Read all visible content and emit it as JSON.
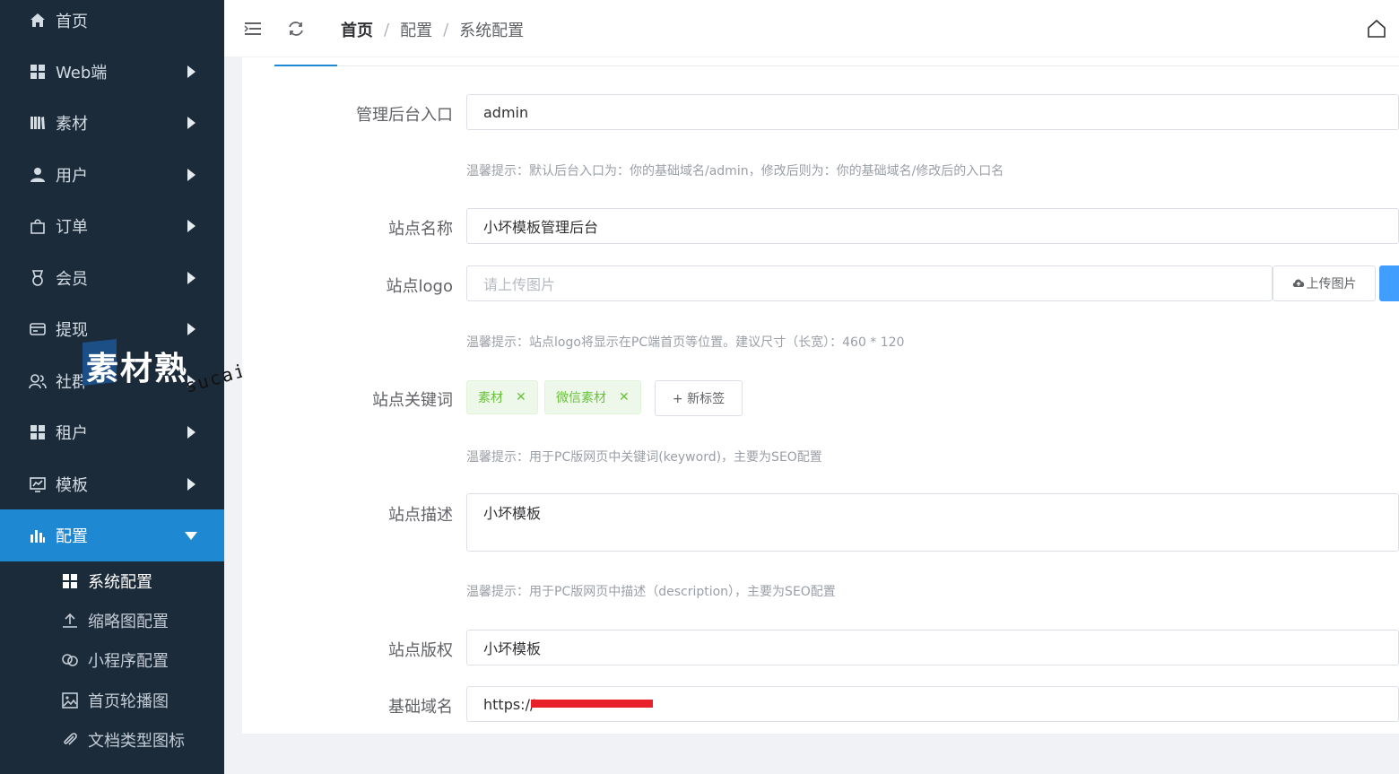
{
  "colors": {
    "sidebar_bg": "#1c2b3a",
    "accent": "#1e88d3",
    "tag_green": "#67c23a",
    "primary_button": "#409eff"
  },
  "sidebar": {
    "items": [
      {
        "label": "首页",
        "icon": "home-icon",
        "has_arrow": false
      },
      {
        "label": "Web端",
        "icon": "grid-icon",
        "has_arrow": true
      },
      {
        "label": "素材",
        "icon": "library-icon",
        "has_arrow": true
      },
      {
        "label": "用户",
        "icon": "user-icon",
        "has_arrow": true
      },
      {
        "label": "订单",
        "icon": "bag-icon",
        "has_arrow": true
      },
      {
        "label": "会员",
        "icon": "medal-icon",
        "has_arrow": true
      },
      {
        "label": "提现",
        "icon": "card-icon",
        "has_arrow": true
      },
      {
        "label": "社群",
        "icon": "group-icon",
        "has_arrow": true
      },
      {
        "label": "租户",
        "icon": "grid-icon",
        "has_arrow": true
      },
      {
        "label": "模板",
        "icon": "chart-board-icon",
        "has_arrow": true
      },
      {
        "label": "配置",
        "icon": "bar-chart-icon",
        "has_arrow": true,
        "active": true
      }
    ],
    "sub_items": [
      {
        "label": "系统配置",
        "icon": "grid-icon",
        "active": true
      },
      {
        "label": "缩略图配置",
        "icon": "upload-icon"
      },
      {
        "label": "小程序配置",
        "icon": "link-icon"
      },
      {
        "label": "首页轮播图",
        "icon": "image-icon"
      },
      {
        "label": "文档类型图标",
        "icon": "paperclip-icon"
      }
    ]
  },
  "header": {
    "breadcrumb": [
      "首页",
      "配置",
      "系统配置"
    ],
    "separator": "/"
  },
  "form": {
    "admin_entry": {
      "label": "管理后台入口",
      "value": "admin",
      "hint": "温馨提示：默认后台入口为：你的基础域名/admin，修改后则为：你的基础域名/修改后的入口名"
    },
    "site_name": {
      "label": "站点名称",
      "value": "小坏模板管理后台"
    },
    "site_logo": {
      "label": "站点logo",
      "placeholder": "请上传图片",
      "upload_label": "上传图片",
      "hint": "温馨提示：站点logo将显示在PC端首页等位置。建议尺寸（长宽）：460 * 120"
    },
    "site_keywords": {
      "label": "站点关键词",
      "tags": [
        "素材",
        "微信素材"
      ],
      "new_tag_label": "+ 新标签",
      "hint": "温馨提示：用于PC版网页中关键词(keyword)，主要为SEO配置"
    },
    "site_description": {
      "label": "站点描述",
      "value": "小坏模板",
      "hint": "温馨提示：用于PC版网页中描述（description），主要为SEO配置"
    },
    "site_copyright": {
      "label": "站点版权",
      "value": "小坏模板"
    },
    "base_domain": {
      "label": "基础域名",
      "value": "https://"
    }
  },
  "watermark": {
    "brand": "素材熟",
    "url": "sucaire.com"
  }
}
